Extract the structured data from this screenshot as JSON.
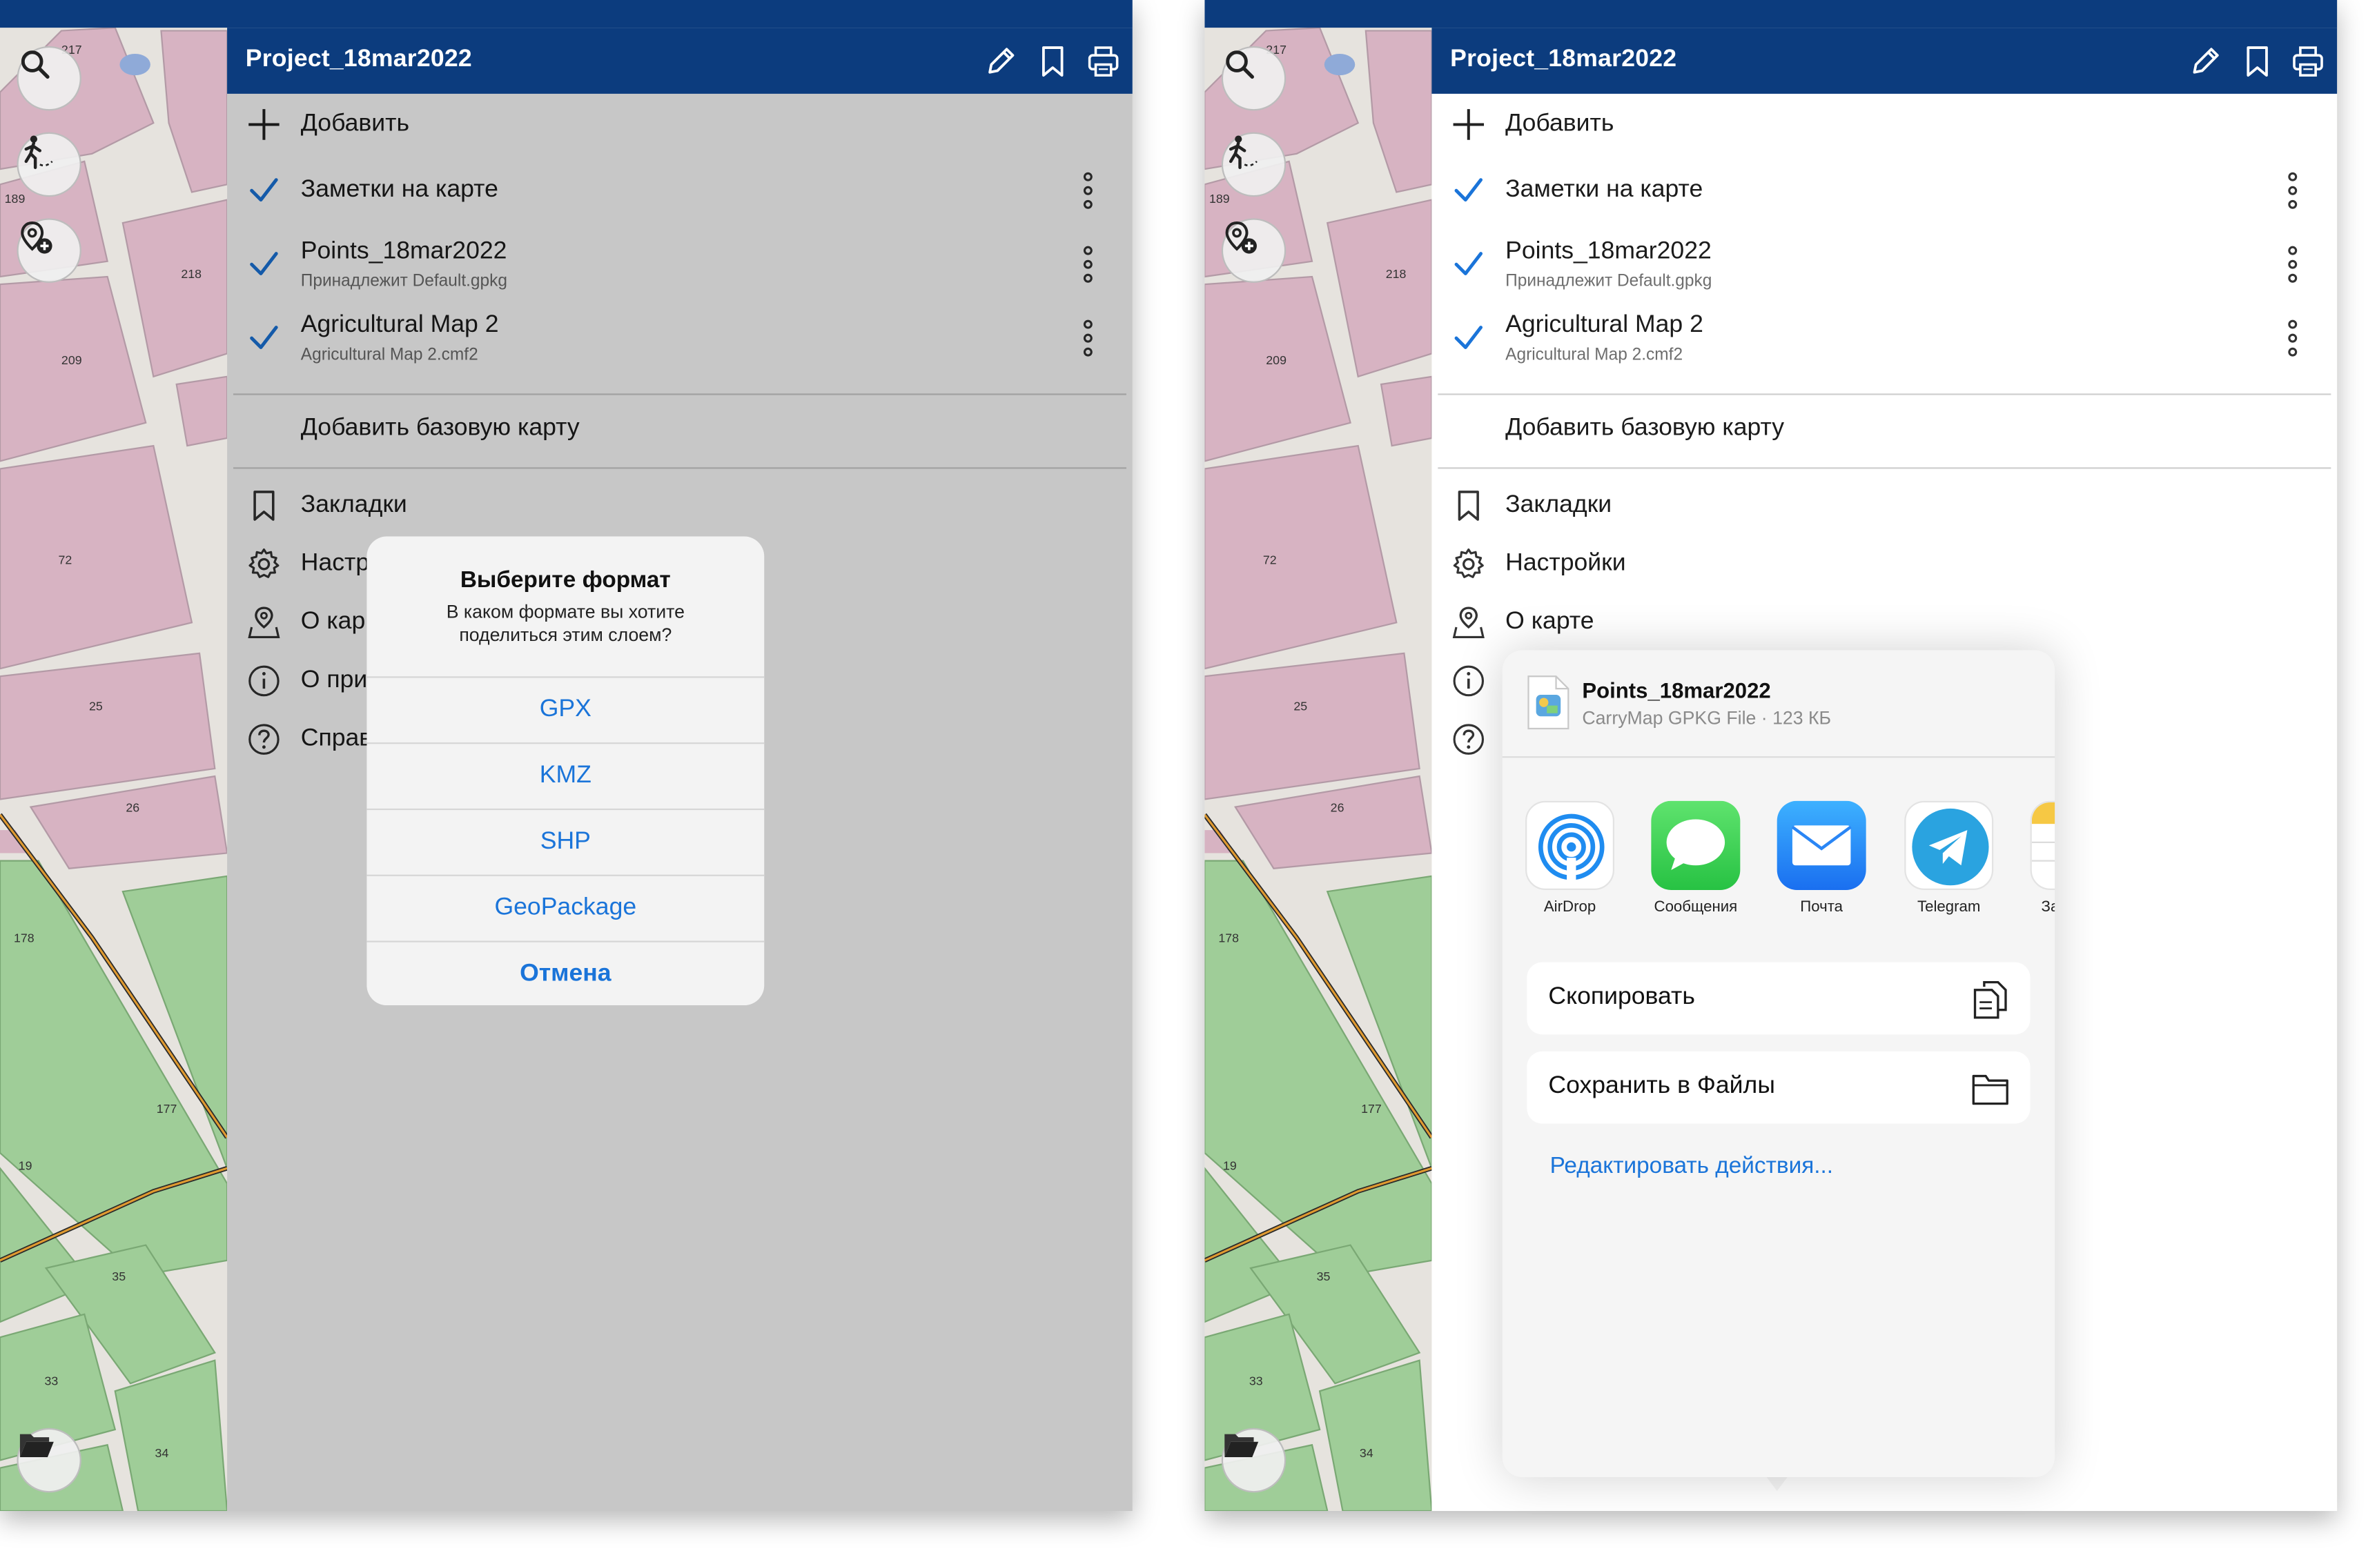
{
  "project_title": "Project_18mar2022",
  "map": {
    "parcel_labels": [
      "217",
      "189",
      "218",
      "209",
      "72",
      "25",
      "26",
      "178",
      "177",
      "19",
      "35",
      "33",
      "34"
    ]
  },
  "menu": {
    "add_label": "Добавить",
    "layers": [
      {
        "label": "Заметки на карте",
        "sub": "",
        "checked": true
      },
      {
        "label": "Points_18mar2022",
        "sub": "Принадлежит Default.gpkg",
        "checked": true
      },
      {
        "label": "Agricultural Map 2",
        "sub": "Agricultural Map 2.cmf2",
        "checked": true
      }
    ],
    "add_basemap": "Добавить базовую карту",
    "items": [
      {
        "label": "Закладки",
        "icon": "bookmark-icon"
      },
      {
        "label": "Настройки",
        "icon": "gear-icon"
      },
      {
        "label": "О карте",
        "icon": "map-pin-icon"
      },
      {
        "label": "О приложении",
        "icon": "info-icon"
      },
      {
        "label": "Справка",
        "icon": "help-icon"
      }
    ],
    "items_truncated_left": [
      "Закладки",
      "Настр",
      "О кар",
      "О при",
      "Справ"
    ]
  },
  "format_dialog": {
    "title": "Выберите формат",
    "message": "В каком формате вы хотите поделиться этим слоем?",
    "options": [
      "GPX",
      "KMZ",
      "SHP",
      "GeoPackage"
    ],
    "cancel": "Отмена"
  },
  "share_sheet": {
    "file_name": "Points_18mar2022",
    "file_meta": "CarryMap GPKG File · 123 КБ",
    "apps": [
      {
        "label": "AirDrop",
        "icon": "airdrop-icon"
      },
      {
        "label": "Сообщения",
        "icon": "messages-icon"
      },
      {
        "label": "Почта",
        "icon": "mail-icon"
      },
      {
        "label": "Telegram",
        "icon": "telegram-icon"
      },
      {
        "label": "За",
        "icon": "notes-icon"
      }
    ],
    "actions": [
      {
        "label": "Скопировать",
        "icon": "copy-icon"
      },
      {
        "label": "Сохранить в Файлы",
        "icon": "folder-icon"
      }
    ],
    "edit_actions": "Редактировать действия..."
  },
  "colors": {
    "header_blue": "#0c3c7e",
    "link_blue": "#1a74d9",
    "parcel_pink": "#d7b3c2",
    "parcel_green": "#9fcd98"
  }
}
